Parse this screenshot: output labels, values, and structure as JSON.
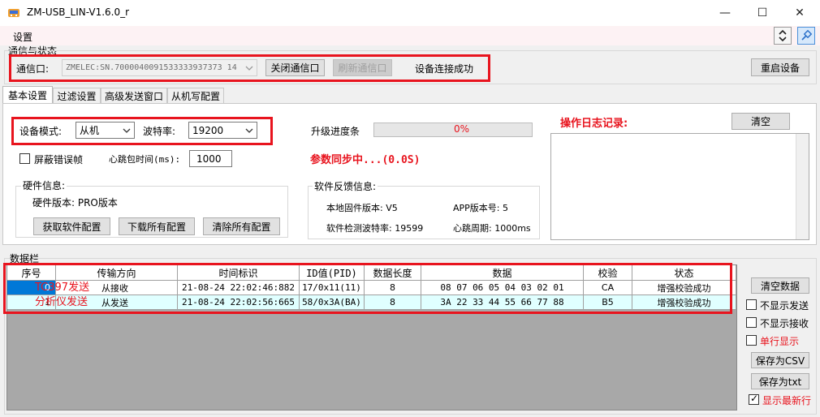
{
  "window": {
    "title": "ZM-USB_LIN-V1.6.0_r",
    "minimize": "—",
    "maximize": "☐",
    "close": "✕"
  },
  "menu": {
    "settings": "设置"
  },
  "comm": {
    "group_label": "通信与状态",
    "port_label": "通信口:",
    "port_value": "ZMELEC:SN.7000040091533333937373 14",
    "close_port": "关闭通信口",
    "refresh_port": "刷新通信口",
    "status": "设备连接成功",
    "restart": "重启设备"
  },
  "tabs": [
    "基本设置",
    "过滤设置",
    "高级发送窗口",
    "从机写配置"
  ],
  "basic": {
    "mode_label": "设备模式:",
    "mode_value": "从机",
    "baud_label": "波特率:",
    "baud_value": "19200",
    "mask_error_label": "屏蔽错误帧",
    "heartbeat_label": "心跳包时间(ms):",
    "heartbeat_value": "1000",
    "hw_group": "硬件信息:",
    "hw_version": "硬件版本: PRO版本",
    "btn_get_config": "获取软件配置",
    "btn_download_all": "下载所有配置",
    "btn_clear_all": "清除所有配置",
    "upgrade_label": "升级进度条",
    "upgrade_percent": "0%",
    "sync_status": "参数同步中...(0.0S)",
    "sw_group": "软件反馈信息:",
    "fw_version": "本地固件版本: V5",
    "app_version": "APP版本号: 5",
    "detected_baud": "软件检测波特率: 19599",
    "heartbeat_period": "心跳周期: 1000ms",
    "log_title": "操作日志记录:",
    "log_clear": "清空"
  },
  "data": {
    "group_label": "数据栏",
    "columns": [
      "序号",
      "传输方向",
      "时间标识",
      "ID值(PID)",
      "数据长度",
      "数据",
      "校验",
      "状态"
    ],
    "rows": [
      [
        "0",
        "从接收",
        "21-08-24 22:02:46:882",
        "17/0x11(11)",
        "8",
        "08 07 06 05 04 03 02 01",
        "CA",
        "增强校验成功"
      ],
      [
        "1",
        "从发送",
        "21-08-24 22:02:56:665",
        "58/0x3A(BA)",
        "8",
        "3A 22 33 44 55 66 77 88",
        "B5",
        "增强校验成功"
      ]
    ],
    "annotations": [
      "TC397发送",
      "分析仪发送"
    ],
    "btn_clear_data": "清空数据",
    "hide_send": "不显示发送",
    "hide_recv": "不显示接收",
    "single_line": "单行显示",
    "save_csv": "保存为CSV",
    "save_txt": "保存为txt",
    "show_latest": "显示最新行"
  },
  "colors": {
    "accent_red": "#e8141e",
    "row_selected": "#0078d7",
    "row_alt": "#e0ffff"
  },
  "icons": [
    "app-icon",
    "collapse-icon",
    "pin-icon",
    "dropdown-arrow-icon"
  ]
}
